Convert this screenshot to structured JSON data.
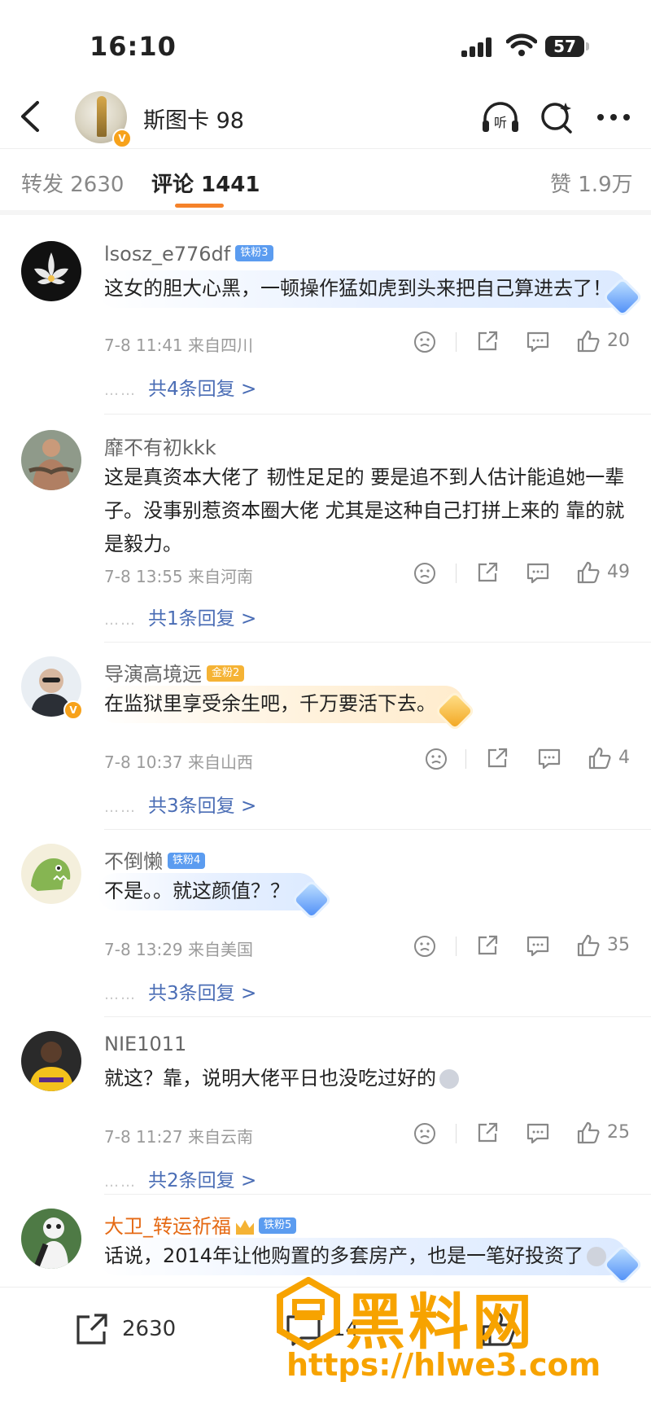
{
  "status": {
    "time": "16:10",
    "battery": "57"
  },
  "nav": {
    "title": "斯图卡 98",
    "listen_label": "听"
  },
  "tabs": [
    {
      "label": "转发 2630"
    },
    {
      "label": "评论 1441"
    },
    {
      "label": "赞 1.9万"
    }
  ],
  "comments": [
    {
      "user": "lsosz_e776df",
      "badge": "铁粉3",
      "text": "这女的胆大心黑，一顿操作猛如虎到头来把自己算进去了！",
      "time": "7-8 11:41 来自四川",
      "likes": "20",
      "replies": "共4条回复 >"
    },
    {
      "user": "靡不有初kkk",
      "badge": "",
      "text": "这是真资本大佬了 韧性足足的 要是追不到人估计能追她一辈子。没事别惹资本圈大佬 尤其是这种自己打拼上来的 靠的就是毅力。",
      "time": "7-8 13:55 来自河南",
      "likes": "49",
      "replies": "共1条回复 >"
    },
    {
      "user": "导演高境远",
      "badge": "金粉2",
      "text": "在监狱里享受余生吧，千万要活下去。",
      "time": "7-8 10:37 来自山西",
      "likes": "4",
      "replies": "共3条回复 >"
    },
    {
      "user": "不倒懒",
      "badge": "铁粉4",
      "text": "不是。。就这颜值？？",
      "time": "7-8 13:29 来自美国",
      "likes": "35",
      "replies": "共3条回复 >"
    },
    {
      "user": "NIE1011",
      "badge": "",
      "text": "就这？靠，说明大佬平日也没吃过好的",
      "time": "7-8 11:27 来自云南",
      "likes": "25",
      "replies": "共2条回复 >"
    },
    {
      "user": "大卫_转运祈福",
      "badge": "铁粉5",
      "text": "话说，2014年让他购置的多套房产，也是一笔好投资了"
    }
  ],
  "bottom": {
    "repost_count": "2630",
    "comment_count": "14"
  },
  "watermark": {
    "logo_text": "黑料网",
    "url": "https://hlwe3.com"
  },
  "colors": {
    "accent": "#f5822a",
    "reply_link": "#4a6db5",
    "watermark": "#f7a300"
  }
}
